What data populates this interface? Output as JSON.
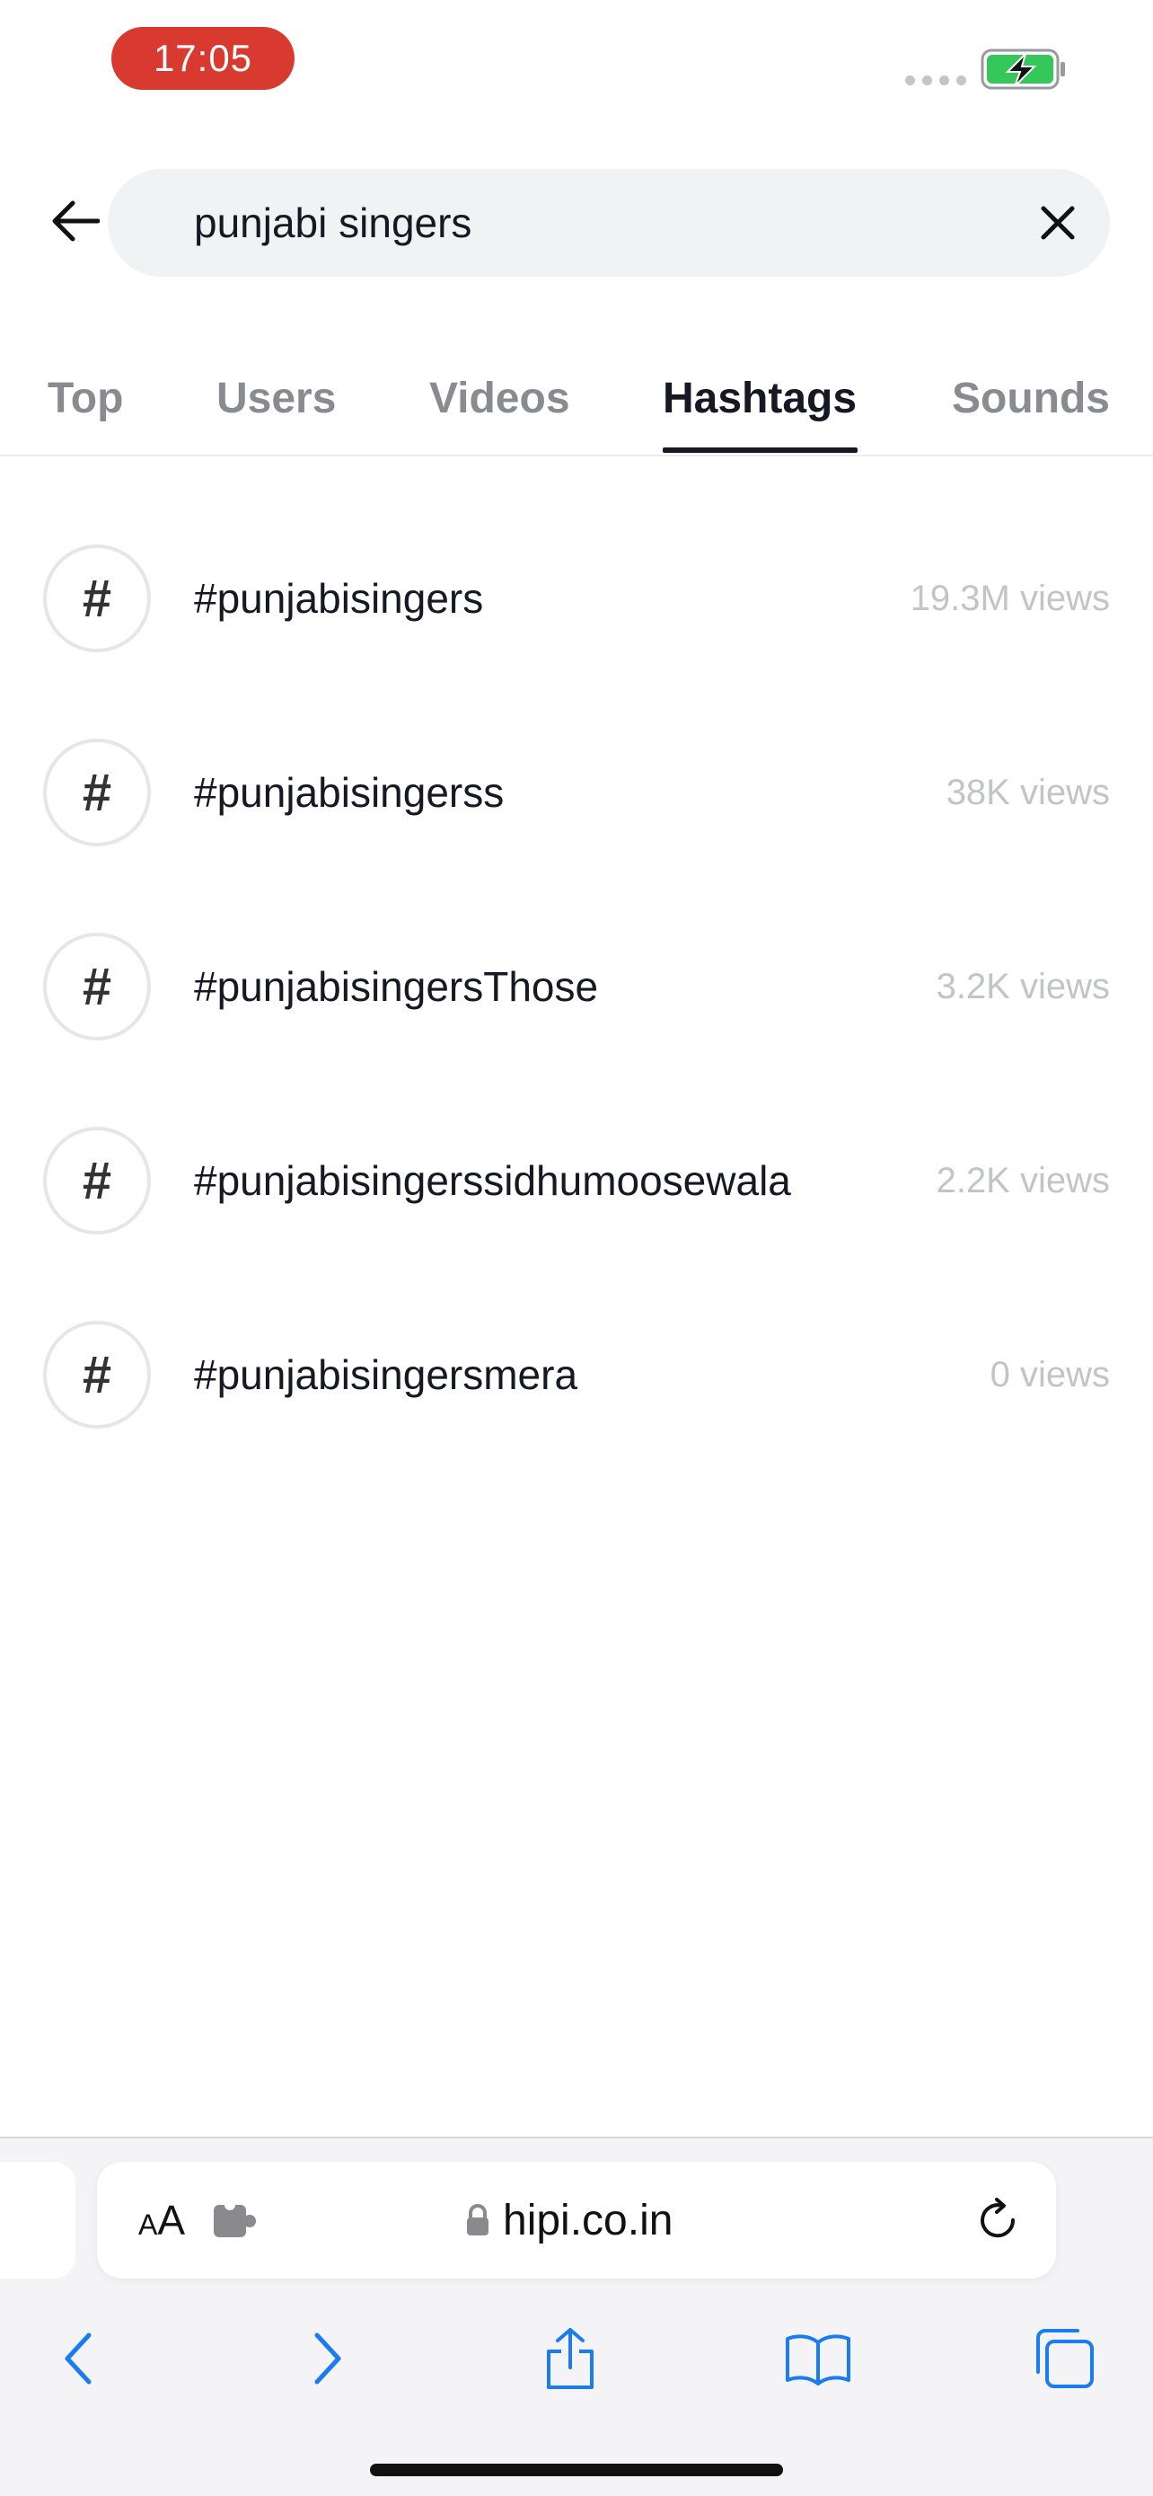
{
  "status_bar": {
    "time": "17:05",
    "battery_color": "#34c759",
    "time_pill_color": "#d93a30"
  },
  "search": {
    "query": "punjabi singers"
  },
  "tabs": [
    {
      "label": "Top"
    },
    {
      "label": "Users"
    },
    {
      "label": "Videos"
    },
    {
      "label": "Hashtags"
    },
    {
      "label": "Sounds"
    }
  ],
  "active_tab": "Hashtags",
  "hashtags": [
    {
      "icon": "#",
      "name": "#punjabisingers",
      "views": "19.3M views"
    },
    {
      "icon": "#",
      "name": "#punjabisingerss",
      "views": "38K views"
    },
    {
      "icon": "#",
      "name": "#punjabisingersThose",
      "views": "3.2K views"
    },
    {
      "icon": "#",
      "name": "#punjabisingerssidhumoosewala",
      "views": "2.2K views"
    },
    {
      "icon": "#",
      "name": "#punjabisingersmera",
      "views": "0 views"
    }
  ],
  "browser": {
    "text_size_label_small": "A",
    "text_size_label_large": "A",
    "url": "hipi.co.in",
    "accent_color": "#1a7cf2"
  }
}
